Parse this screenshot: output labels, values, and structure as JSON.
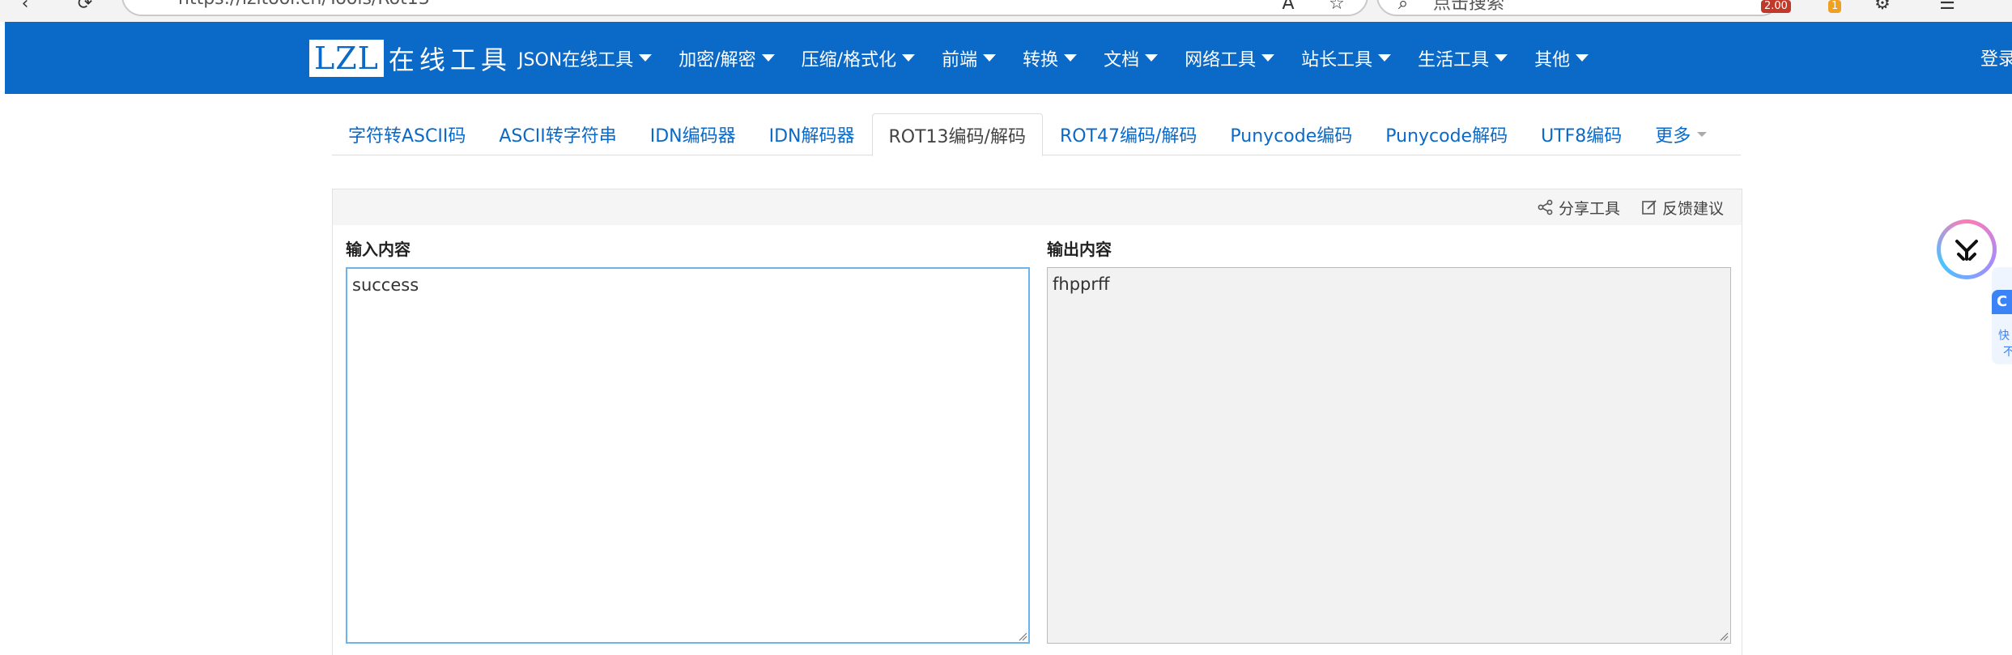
{
  "browser": {
    "url": "https://lzltool.cn/Tools/Rot13",
    "search_placeholder": "点击搜索",
    "badge_red": "2.00",
    "badge_orange": "1"
  },
  "navbar": {
    "logo_box": "LZL",
    "logo_text": "在线工具",
    "items": [
      {
        "label": "JSON在线工具"
      },
      {
        "label": "加密/解密"
      },
      {
        "label": "压缩/格式化"
      },
      {
        "label": "前端"
      },
      {
        "label": "转换"
      },
      {
        "label": "文档"
      },
      {
        "label": "网络工具"
      },
      {
        "label": "站长工具"
      },
      {
        "label": "生活工具"
      },
      {
        "label": "其他"
      }
    ],
    "login": "登录"
  },
  "tabs": [
    {
      "label": "字符转ASCII码"
    },
    {
      "label": "ASCII转字符串"
    },
    {
      "label": "IDN编码器"
    },
    {
      "label": "IDN解码器"
    },
    {
      "label": "ROT13编码/解码",
      "active": true
    },
    {
      "label": "ROT47编码/解码"
    },
    {
      "label": "Punycode编码"
    },
    {
      "label": "Punycode解码"
    },
    {
      "label": "UTF8编码"
    },
    {
      "label": "更多"
    }
  ],
  "panel": {
    "share_label": "分享工具",
    "feedback_label": "反馈建议",
    "input_label": "输入内容",
    "input_value": "success",
    "output_label": "输出内容",
    "output_value": "fhpprff"
  },
  "side_widget": {
    "top_char": "C",
    "line1": "快",
    "line2": "不"
  },
  "colors": {
    "navbar": "#0b69c7",
    "link": "#0b69c7",
    "input_border": "#6eb3ea",
    "output_bg": "#f2f2f2"
  }
}
